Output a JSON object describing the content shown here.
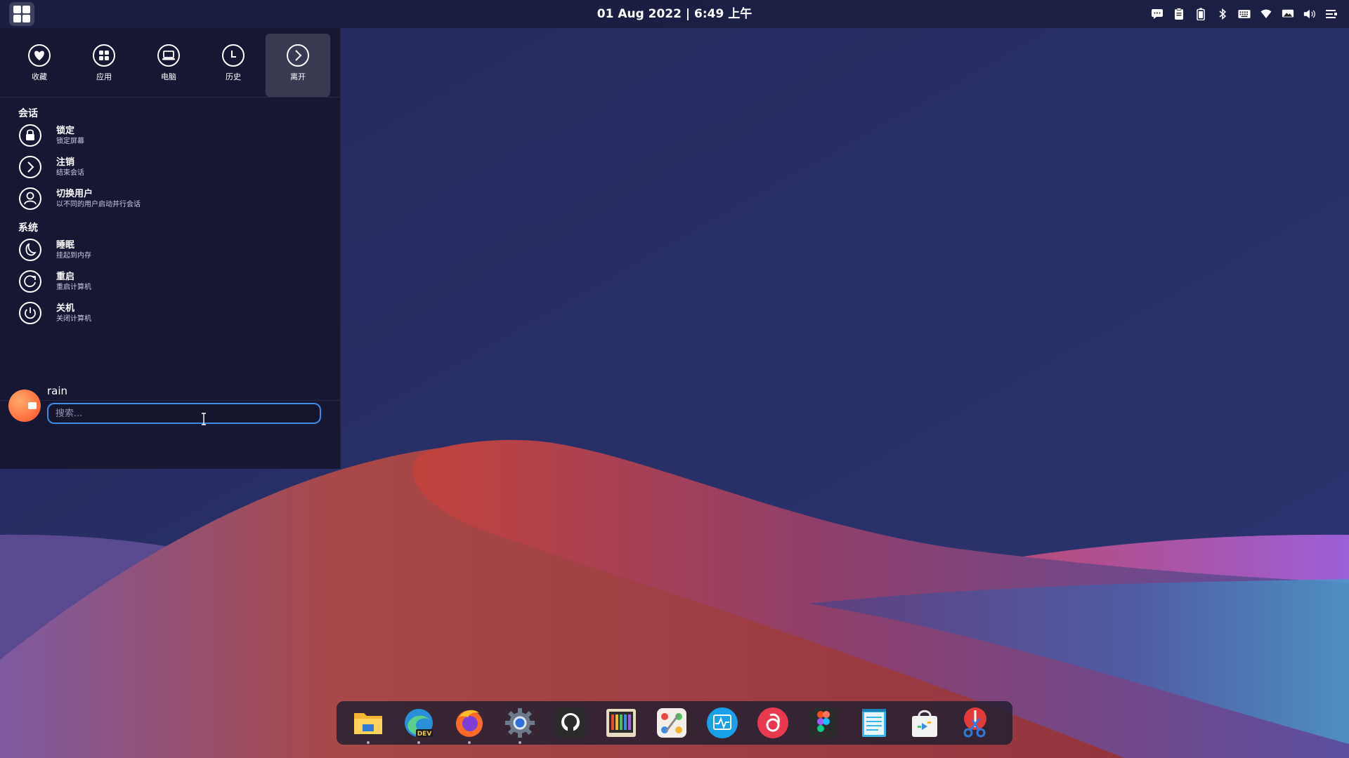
{
  "top_panel": {
    "clock": "01 Aug 2022 | 6:49 上午",
    "launcher_icon": "grid-icon",
    "tray_icons": [
      "chat-icon",
      "clipboard-icon",
      "battery-icon",
      "bluetooth-icon",
      "keyboard-icon",
      "wifi-icon",
      "screen-icon",
      "volume-icon",
      "menu-icon"
    ]
  },
  "menu": {
    "tabs": [
      {
        "label": "收藏",
        "icon": "heart-icon"
      },
      {
        "label": "应用",
        "icon": "apps-icon"
      },
      {
        "label": "电脑",
        "icon": "computer-icon"
      },
      {
        "label": "历史",
        "icon": "clock-icon"
      },
      {
        "label": "离开",
        "icon": "leave-icon"
      }
    ],
    "active_tab": "离开",
    "sections": [
      {
        "title": "会话",
        "items": [
          {
            "title": "锁定",
            "desc": "锁定屏幕",
            "icon": "lock-icon"
          },
          {
            "title": "注销",
            "desc": "结束会话",
            "icon": "logout-icon"
          },
          {
            "title": "切换用户",
            "desc": "以不同的用户启动并行会话",
            "icon": "user-icon"
          }
        ]
      },
      {
        "title": "系统",
        "items": [
          {
            "title": "睡眠",
            "desc": "挂起到内存",
            "icon": "moon-icon"
          },
          {
            "title": "重启",
            "desc": "重启计算机",
            "icon": "restart-icon"
          },
          {
            "title": "关机",
            "desc": "关闭计算机",
            "icon": "power-icon"
          }
        ]
      }
    ],
    "user": {
      "name": "rain"
    },
    "search": {
      "placeholder": "搜索...",
      "value": ""
    }
  },
  "dock": {
    "apps": [
      {
        "name": "files",
        "icon": "folder-icon",
        "running": true
      },
      {
        "name": "edge-dev",
        "icon": "edge-dev-icon",
        "badge": "DEV",
        "running": true
      },
      {
        "name": "firefox",
        "icon": "firefox-icon",
        "running": true
      },
      {
        "name": "settings",
        "icon": "gear-icon",
        "running": true
      },
      {
        "name": "github",
        "icon": "github-icon",
        "running": false
      },
      {
        "name": "media",
        "icon": "media-icon",
        "running": false
      },
      {
        "name": "paint",
        "icon": "paint-icon",
        "running": false
      },
      {
        "name": "system-monitor",
        "icon": "monitor-icon",
        "running": false
      },
      {
        "name": "netease-music",
        "icon": "music-icon",
        "running": false
      },
      {
        "name": "figma",
        "icon": "figma-icon",
        "running": false
      },
      {
        "name": "notes",
        "icon": "notepad-icon",
        "running": false
      },
      {
        "name": "store",
        "icon": "store-icon",
        "running": false
      },
      {
        "name": "screenshot",
        "icon": "scissors-icon",
        "running": false
      }
    ]
  },
  "colors": {
    "accent": "#3d8be6",
    "panel": "#181b3a",
    "wallpaper_red": "#b7403a",
    "wallpaper_purple": "#7a4f9a"
  }
}
